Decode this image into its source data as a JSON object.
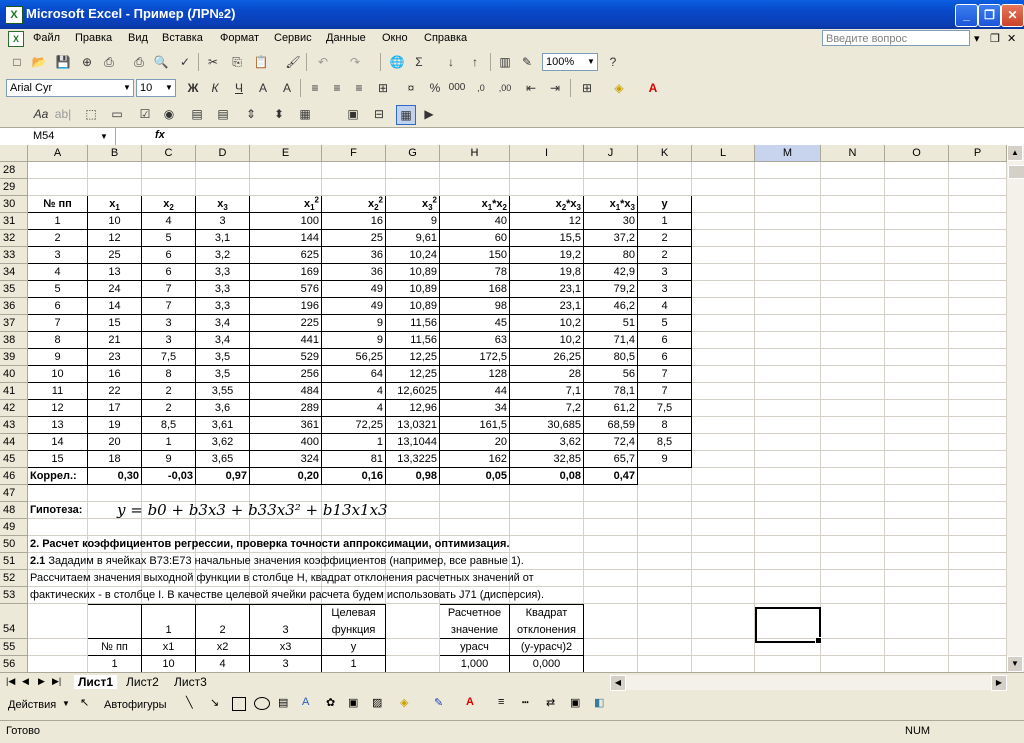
{
  "window": {
    "title": "Microsoft Excel - Пример (ЛР№2)"
  },
  "menu": [
    "Файл",
    "Правка",
    "Вид",
    "Вставка",
    "Формат",
    "Сервис",
    "Данные",
    "Окно",
    "Справка"
  ],
  "ask_placeholder": "Введите вопрос",
  "toolbar": {
    "zoom": "100%",
    "font": "Arial Cyr",
    "size": "10"
  },
  "namebox": "M54",
  "fx": "fx",
  "columns": [
    "A",
    "B",
    "C",
    "D",
    "E",
    "F",
    "G",
    "H",
    "I",
    "J",
    "K",
    "L",
    "M",
    "N",
    "O",
    "P"
  ],
  "selected_column": "M",
  "rows": [
    {
      "n": "28"
    },
    {
      "n": "29"
    },
    {
      "n": "30"
    },
    {
      "n": "31"
    },
    {
      "n": "32"
    },
    {
      "n": "33"
    },
    {
      "n": "34"
    },
    {
      "n": "35"
    },
    {
      "n": "36"
    },
    {
      "n": "37"
    },
    {
      "n": "38"
    },
    {
      "n": "39"
    },
    {
      "n": "40"
    },
    {
      "n": "41"
    },
    {
      "n": "42"
    },
    {
      "n": "43"
    },
    {
      "n": "44"
    },
    {
      "n": "45"
    },
    {
      "n": "46"
    },
    {
      "n": "47"
    },
    {
      "n": "48"
    },
    {
      "n": "49"
    },
    {
      "n": "50"
    },
    {
      "n": "51"
    },
    {
      "n": "52"
    },
    {
      "n": "53"
    },
    {
      "n": "54"
    },
    {
      "n": "55"
    },
    {
      "n": "56"
    }
  ],
  "table_header": [
    "№ пп",
    "x1",
    "x2",
    "x3",
    "x1^2",
    "x2^2",
    "x3^2",
    "x1*x2",
    "x2*x3",
    "x1*x3",
    "y"
  ],
  "table_rows": [
    [
      "1",
      "10",
      "4",
      "3",
      "100",
      "16",
      "9",
      "40",
      "12",
      "30",
      "1"
    ],
    [
      "2",
      "12",
      "5",
      "3,1",
      "144",
      "25",
      "9,61",
      "60",
      "15,5",
      "37,2",
      "2"
    ],
    [
      "3",
      "25",
      "6",
      "3,2",
      "625",
      "36",
      "10,24",
      "150",
      "19,2",
      "80",
      "2"
    ],
    [
      "4",
      "13",
      "6",
      "3,3",
      "169",
      "36",
      "10,89",
      "78",
      "19,8",
      "42,9",
      "3"
    ],
    [
      "5",
      "24",
      "7",
      "3,3",
      "576",
      "49",
      "10,89",
      "168",
      "23,1",
      "79,2",
      "3"
    ],
    [
      "6",
      "14",
      "7",
      "3,3",
      "196",
      "49",
      "10,89",
      "98",
      "23,1",
      "46,2",
      "4"
    ],
    [
      "7",
      "15",
      "3",
      "3,4",
      "225",
      "9",
      "11,56",
      "45",
      "10,2",
      "51",
      "5"
    ],
    [
      "8",
      "21",
      "3",
      "3,4",
      "441",
      "9",
      "11,56",
      "63",
      "10,2",
      "71,4",
      "6"
    ],
    [
      "9",
      "23",
      "7,5",
      "3,5",
      "529",
      "56,25",
      "12,25",
      "172,5",
      "26,25",
      "80,5",
      "6"
    ],
    [
      "10",
      "16",
      "8",
      "3,5",
      "256",
      "64",
      "12,25",
      "128",
      "28",
      "56",
      "7"
    ],
    [
      "11",
      "22",
      "2",
      "3,55",
      "484",
      "4",
      "12,6025",
      "44",
      "7,1",
      "78,1",
      "7"
    ],
    [
      "12",
      "17",
      "2",
      "3,6",
      "289",
      "4",
      "12,96",
      "34",
      "7,2",
      "61,2",
      "7,5"
    ],
    [
      "13",
      "19",
      "8,5",
      "3,61",
      "361",
      "72,25",
      "13,0321",
      "161,5",
      "30,685",
      "68,59",
      "8"
    ],
    [
      "14",
      "20",
      "1",
      "3,62",
      "400",
      "1",
      "13,1044",
      "20",
      "3,62",
      "72,4",
      "8,5"
    ],
    [
      "15",
      "18",
      "9",
      "3,65",
      "324",
      "81",
      "13,3225",
      "162",
      "32,85",
      "65,7",
      "9"
    ]
  ],
  "correl": [
    "Коррел.:",
    "0,30",
    "-0,03",
    "0,97",
    "0,20",
    "0,16",
    "0,98",
    "0,05",
    "0,08",
    "0,47"
  ],
  "hypothesis_label": "Гипотеза:",
  "hypothesis_formula": "y = b0 + b3x3 + b33x3² + b13x1x3",
  "section_title": "2. Расчет коэффициентов регрессии, проверка точности аппроксимации, оптимизация.",
  "text51_bold": "2.1",
  "text51": " Зададим в ячейках B73:E73 начальные значения коэффициентов (например, все равные 1).",
  "text52": "Рассчитаем значения выходной функции в столбце H, квадрат отклонения расчетных значений от",
  "text53": "фактических - в столбце I. В качестве целевой ячейки расчета будем использовать J71 (дисперсия).",
  "t2_row54": [
    "",
    "1",
    "2",
    "3",
    "Целевая функция",
    "Расчетное значение",
    "Квадрат отклонения"
  ],
  "t2_row55": [
    "№ пп",
    "x1",
    "x2",
    "x3",
    "y",
    "урасч",
    "(у-урасч)2"
  ],
  "t2_row56": [
    "1",
    "10",
    "4",
    "3",
    "1",
    "1,000",
    "0,000"
  ],
  "sheets": [
    "Лист1",
    "Лист2",
    "Лист3"
  ],
  "active_sheet": "Лист1",
  "draw": {
    "actions": "Действия",
    "autoshapes": "Автофигуры"
  },
  "status": {
    "ready": "Готово",
    "num": "NUM"
  }
}
